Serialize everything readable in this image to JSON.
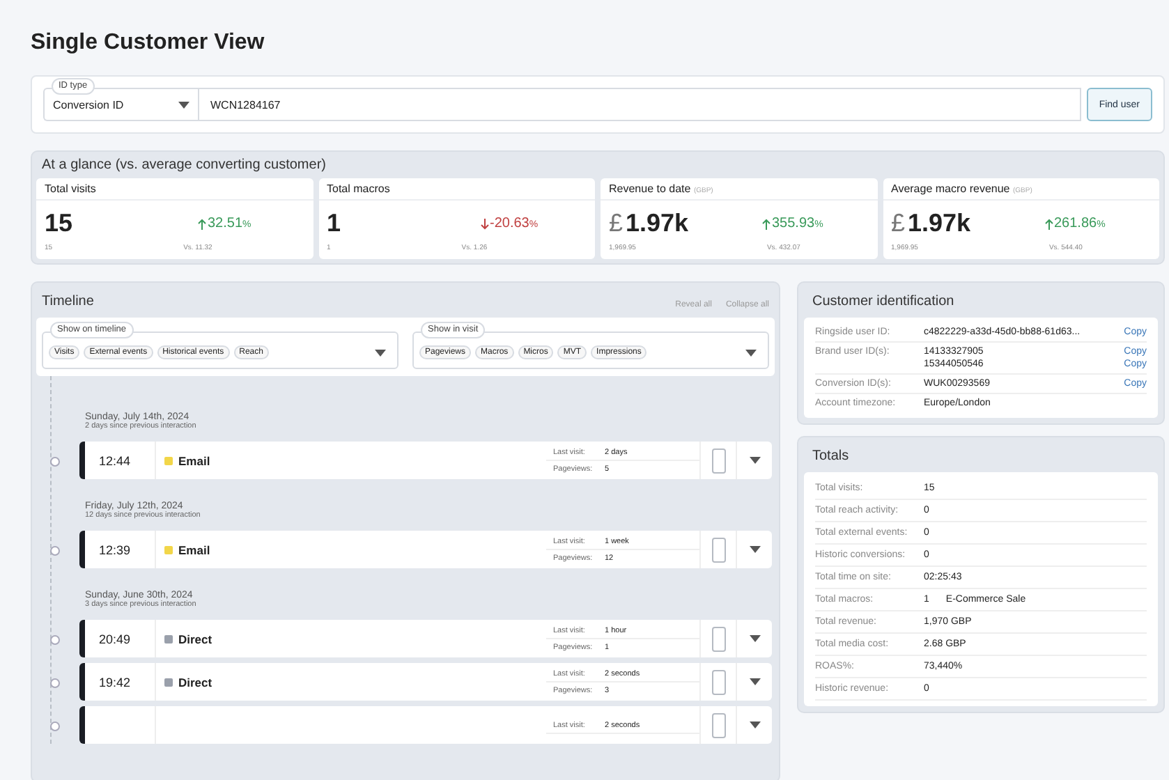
{
  "title": "Single Customer View",
  "search": {
    "id_type_label": "ID type",
    "id_type": "Conversion ID",
    "value": "WCN1284167",
    "button": "Find user"
  },
  "glance": {
    "title": "At a glance (vs. average converting customer)",
    "stats": [
      {
        "label": "Total visits",
        "value": "15",
        "change": "32.51",
        "rising": true,
        "pct": "%",
        "exact": "15",
        "average": "Vs. 11.32"
      },
      {
        "label": "Total macros",
        "value": "1",
        "change": "-20.63",
        "rising": false,
        "pct": "%",
        "exact": "1",
        "average": "Vs. 1.26"
      },
      {
        "label": "Revenue to date",
        "unit": "(GBP)",
        "currency": "£",
        "value": "1.97k",
        "change": "355.93",
        "rising": true,
        "pct": "%",
        "exact": "1,969.95",
        "average": "Vs. 432.07"
      },
      {
        "label": "Average macro revenue",
        "unit": "(GBP)",
        "currency": "£",
        "value": "1.97k",
        "change": "261.86",
        "rising": true,
        "pct": "%",
        "exact": "1,969.95",
        "average": "Vs. 544.40"
      }
    ]
  },
  "timeline": {
    "title": "Timeline",
    "actions": [
      "Reveal all",
      "Collapse all"
    ],
    "filters": [
      {
        "label": "Show on timeline",
        "chips": [
          "Visits",
          "External events",
          "Historical events",
          "Reach"
        ]
      },
      {
        "label": "Show in visit",
        "chips": [
          "Pageviews",
          "Macros",
          "Micros",
          "MVT",
          "Impressions"
        ]
      }
    ],
    "days": [
      {
        "date": "Sunday, July 14th, 2024",
        "since": "2 days since previous interaction",
        "visits": [
          {
            "time": "12:44",
            "source": "Email",
            "color": "#f2d649",
            "last_visit_label": "Last visit:",
            "last_visit": "2 days",
            "pageviews_label": "Pageviews:",
            "pageviews": "5"
          }
        ]
      },
      {
        "date": "Friday, July 12th, 2024",
        "since": "12 days since previous interaction",
        "visits": [
          {
            "time": "12:39",
            "source": "Email",
            "color": "#f2d649",
            "last_visit_label": "Last visit:",
            "last_visit": "1 week",
            "pageviews_label": "Pageviews:",
            "pageviews": "12"
          }
        ]
      },
      {
        "date": "Sunday, June 30th, 2024",
        "since": "3 days since previous interaction",
        "visits": [
          {
            "time": "20:49",
            "source": "Direct",
            "color": "#9aa0ab",
            "last_visit_label": "Last visit:",
            "last_visit": "1 hour",
            "pageviews_label": "Pageviews:",
            "pageviews": "1"
          },
          {
            "time": "19:42",
            "source": "Direct",
            "color": "#9aa0ab",
            "last_visit_label": "Last visit:",
            "last_visit": "2 seconds",
            "pageviews_label": "Pageviews:",
            "pageviews": "3"
          },
          {
            "last_visit_label": "Last visit:",
            "last_visit": "2 seconds"
          }
        ]
      }
    ]
  },
  "identification": {
    "title": "Customer identification",
    "rows": [
      {
        "label": "Ringside user ID:",
        "values": [
          {
            "text": "c4822229-a33d-45d0-bb88-61d63...",
            "copy": "Copy"
          }
        ]
      },
      {
        "label": "Brand user ID(s):",
        "values": [
          {
            "text": "14133327905",
            "copy": "Copy"
          },
          {
            "text": "15344050546",
            "copy": "Copy"
          }
        ]
      },
      {
        "label": "Conversion ID(s):",
        "values": [
          {
            "text": "WUK00293569",
            "copy": "Copy"
          }
        ]
      },
      {
        "label": "Account timezone:",
        "values": [
          {
            "text": "Europe/London"
          }
        ]
      }
    ]
  },
  "totals": {
    "title": "Totals",
    "rows": [
      {
        "label": "Total visits:",
        "value": "15"
      },
      {
        "label": "Total reach activity:",
        "value": "0"
      },
      {
        "label": "Total external events:",
        "value": "0"
      },
      {
        "label": "Historic conversions:",
        "value": "0"
      },
      {
        "label": "Total time on site:",
        "value": "02:25:43"
      },
      {
        "label": "Total macros:",
        "value": "1",
        "extra": "E-Commerce Sale"
      },
      {
        "label": "Total revenue:",
        "value": "1,970 GBP"
      },
      {
        "label": "Total media cost:",
        "value": "2.68 GBP"
      },
      {
        "label": "ROAS%:",
        "value": "73,440%"
      },
      {
        "label": "Historic revenue:",
        "value": "0"
      }
    ]
  }
}
